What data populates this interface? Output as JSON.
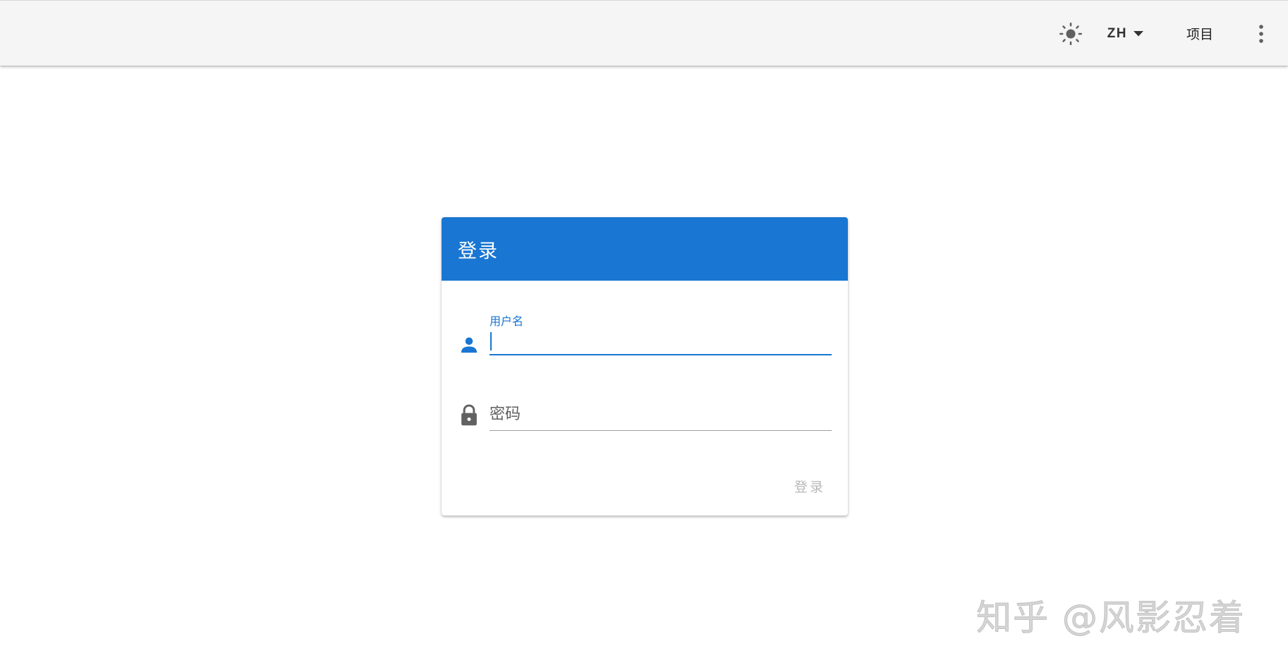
{
  "appbar": {
    "theme_icon": "sun-icon",
    "language": "ZH",
    "project_label": "项目",
    "more_icon": "more-vert-icon"
  },
  "login_card": {
    "title": "登录",
    "username": {
      "label": "用户名",
      "value": "",
      "icon": "person-icon"
    },
    "password": {
      "placeholder": "密码",
      "value": "",
      "icon": "lock-icon"
    },
    "submit_label": "登录"
  },
  "watermark": "知乎 @风影忍着",
  "colors": {
    "primary": "#1976d2",
    "appbar_bg": "#f5f5f5",
    "icon_gray": "#616161",
    "disabled_text": "#b8b8b8"
  }
}
